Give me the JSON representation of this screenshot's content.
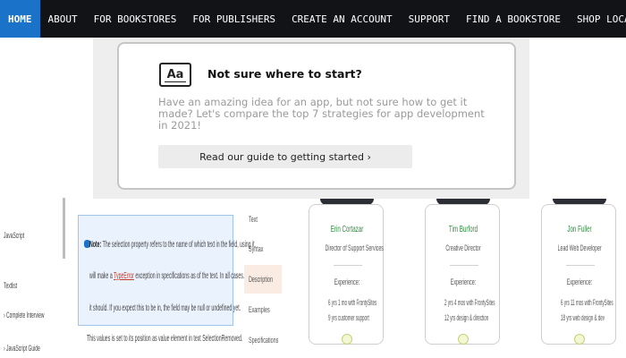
{
  "nav": {
    "items": [
      "HOME",
      "ABOUT",
      "FOR BOOKSTORES",
      "FOR PUBLISHERS",
      "CREATE AN ACCOUNT",
      "SUPPORT",
      "FIND A BOOKSTORE",
      "SHOP LOCAL"
    ],
    "active_index": 0,
    "active_color": "#1a73c9"
  },
  "guide_card": {
    "icon_text": "Aa",
    "title": "Not sure where to start?",
    "body": "Have an amazing idea for an app, but not sure how to get it made? Let's compare the top 7 strategies for app development in 2021!",
    "button_label": "Read our guide to getting started ›"
  },
  "sidebar": {
    "items": [
      "JavaScript",
      "Textlist",
      "› Complete Interview",
      "› JavaScript Guide"
    ]
  },
  "info_box": {
    "lead": "Note:",
    "line1": "The selection property refers to the name of which text in the field, using it.",
    "line2_pre": "will make a",
    "line2_link": "TypeError",
    "line2_post": "exception in specifications as of the text. In all cases.",
    "line3": "it should. If you expect this to be in, the field may be null or undefined yet.",
    "below": "This values is set to its position as value element in text SelectionRemoved."
  },
  "mid_tabs": [
    "Text",
    "Syntax",
    "Description",
    "Examples",
    "Specifications"
  ],
  "mid_tabs_active": 2,
  "team": [
    {
      "name": "Erin Cortazar",
      "role": "Director of Support Services",
      "exp_label": "Experience:",
      "line1": "6 yrs 1 mo with FrontySites",
      "line2": "9 yrs customer support"
    },
    {
      "name": "Tim Burford",
      "role": "Creative Director",
      "exp_label": "Experience:",
      "line1": "2 yrs 4 mos with FrontySites",
      "line2": "12 yrs design & direction"
    },
    {
      "name": "Jon Fuller",
      "role": "Lead Web Developer",
      "exp_label": "Experience:",
      "line1": "6 yrs 11 mos with FrontySites",
      "line2": "18 yrs web design & dev"
    }
  ],
  "colors": {
    "nav_bg": "#111317",
    "name_green": "#2e8b3e",
    "info_bg": "#eaf3fd"
  }
}
